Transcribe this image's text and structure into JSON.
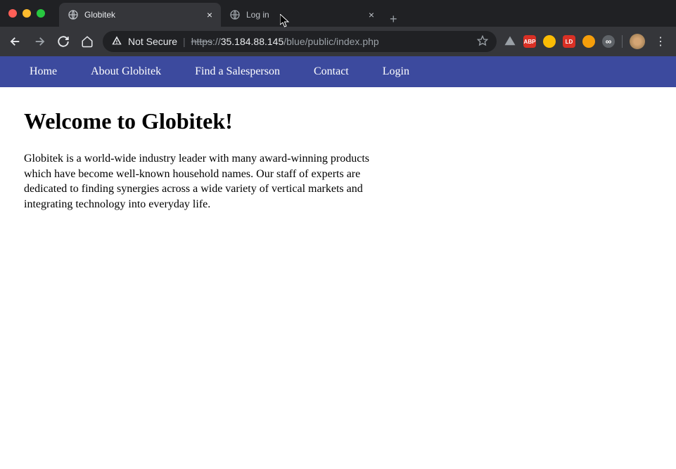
{
  "browser": {
    "tabs": [
      {
        "title": "Globitek",
        "active": true
      },
      {
        "title": "Log in",
        "active": false
      }
    ],
    "security_label": "Not Secure",
    "url": {
      "protocol": "https",
      "host": "35.184.88.145",
      "path": "/blue/public/index.php"
    },
    "extensions": [
      {
        "name": "drive",
        "bg": "#5f6368",
        "label": ""
      },
      {
        "name": "abp",
        "bg": "#d93025",
        "label": "ABP"
      },
      {
        "name": "coin",
        "bg": "#fbbc04",
        "label": ""
      },
      {
        "name": "ld",
        "bg": "#d93025",
        "label": "LD"
      },
      {
        "name": "cookie",
        "bg": "#f59e0b",
        "label": ""
      },
      {
        "name": "infinity",
        "bg": "#5f6368",
        "label": "∞"
      }
    ]
  },
  "nav": {
    "items": [
      "Home",
      "About Globitek",
      "Find a Salesperson",
      "Contact",
      "Login"
    ]
  },
  "page": {
    "heading": "Welcome to Globitek!",
    "intro": "Globitek is a world-wide industry leader with many award-winning products which have become well-known household names. Our staff of experts are dedicated to finding synergies across a wide variety of vertical markets and integrating technology into everyday life."
  }
}
